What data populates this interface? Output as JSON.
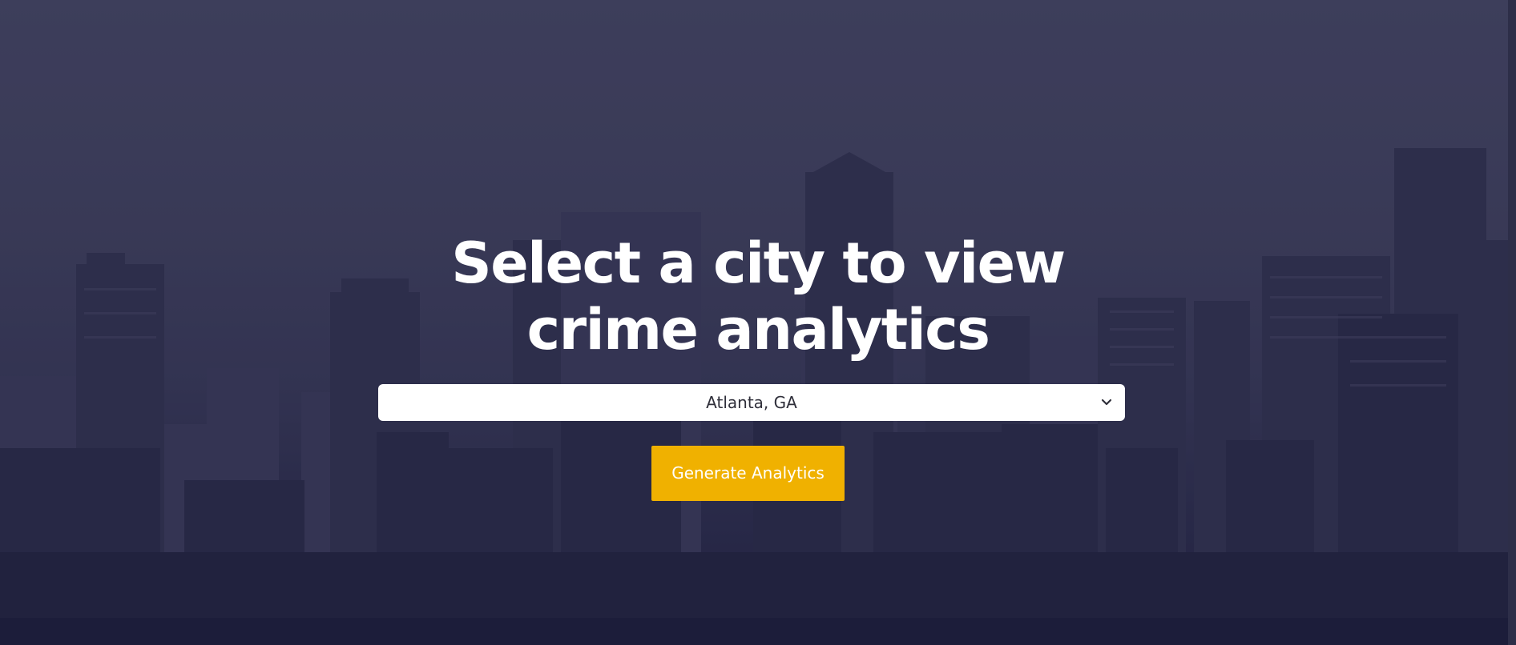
{
  "hero": {
    "headline_line1": "Select a city to view",
    "headline_line2": "crime analytics"
  },
  "city_select": {
    "selected_value": "Atlanta, GA",
    "chevron_icon": "chevron-down-icon"
  },
  "generate_button": {
    "label": "Generate Analytics",
    "color": "#f0b100"
  },
  "colors": {
    "overlay": "#2a2b47",
    "headline": "#ffffff"
  }
}
